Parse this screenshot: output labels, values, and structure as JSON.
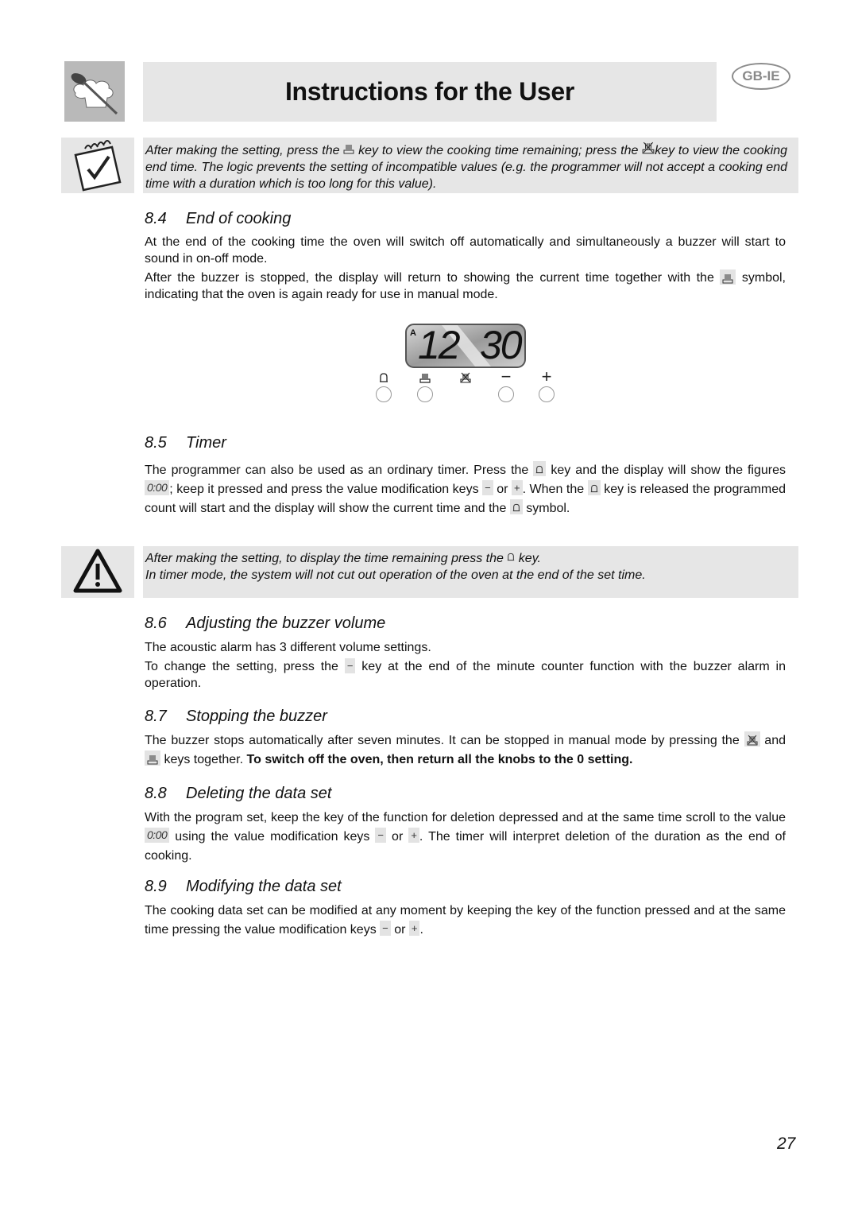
{
  "header": {
    "title": "Instructions for the User",
    "region_badge": "GB-IE",
    "logo_icon": "chef-hat-spoon-icon"
  },
  "note": {
    "icon": "notepad-check-icon",
    "text_1": "After making the setting, press the",
    "key_1": "cooking-duration-icon",
    "text_2": "key to view the cooking time remaining; press the",
    "key_2": "cooking-end-icon",
    "text_3": "key to view the cooking end time. The logic prevents the setting of incompatible values (e.g. the programmer will not accept a cooking end time with a duration which is too long for this value)."
  },
  "sections": [
    {
      "number": "8.4",
      "title": "End of cooking",
      "p1": "At the end of the cooking time the oven will switch off automatically and simultaneously a buzzer will start to sound in on-off mode.",
      "p2_a": "After the buzzer is stopped, the display will return to showing the current time together with the",
      "p2_b": "symbol, indicating that the oven is again ready for use in manual mode."
    },
    {
      "number": "8.5",
      "title": "Timer",
      "p1_a": "The programmer can also be used as an ordinary timer. Press the",
      "p1_b": "key and the display will show the figures",
      "figures": "0:00",
      "p1_c": "; keep it pressed and press the value modification keys",
      "p1_d": "or",
      "p1_e": ". When the",
      "p1_f": "key is released the programmed count will start and the display will show the current time and the",
      "p1_g": "symbol."
    },
    {
      "number": "8.6",
      "title": "Adjusting the buzzer volume",
      "p1": "The acoustic alarm has 3 different volume settings.",
      "p2_a": "To change the setting, press the",
      "p2_b": "key at the end of the minute counter function with the buzzer alarm in operation."
    },
    {
      "number": "8.7",
      "title": "Stopping the buzzer",
      "p1_a": "The buzzer stops automatically after seven minutes. It can be stopped in manual mode by pressing the",
      "p1_b": "and",
      "p1_c": "keys together.",
      "p1_bold": "To switch off the oven, then return all the knobs to the 0 setting."
    },
    {
      "number": "8.8",
      "title": "Deleting the data set",
      "p1_a": "With the program set, keep the key of the function for deletion depressed and at the same time scroll to the value",
      "value": "0:00",
      "p1_b": "using the value modification keys",
      "p1_c": "or",
      "p1_d": ". The timer will interpret deletion of the duration as the end of cooking."
    },
    {
      "number": "8.9",
      "title": "Modifying the data set",
      "p1_a": "The cooking data set can be modified at any moment by keeping the key of the function pressed and at the same time pressing the value modification keys",
      "p1_b": "or",
      "p1_c": "."
    }
  ],
  "warning": {
    "icon": "warning-triangle-icon",
    "line1_a": "After making the setting, to display the time remaining press the",
    "line1_b": "key.",
    "line2": "In timer mode, the system will not cut out operation of the oven at the end of the set time."
  },
  "programmer_panel": {
    "display_mode": "A",
    "display_hours": "12",
    "display_minutes": "30",
    "buttons": [
      {
        "name": "timer-bell",
        "glyph": "bell"
      },
      {
        "name": "cooking-duration",
        "glyph": "pot"
      },
      {
        "name": "cooking-end",
        "glyph": "pot-crossed"
      },
      {
        "name": "minus",
        "glyph": "−"
      },
      {
        "name": "plus",
        "glyph": "+"
      }
    ]
  },
  "page_number": "27"
}
